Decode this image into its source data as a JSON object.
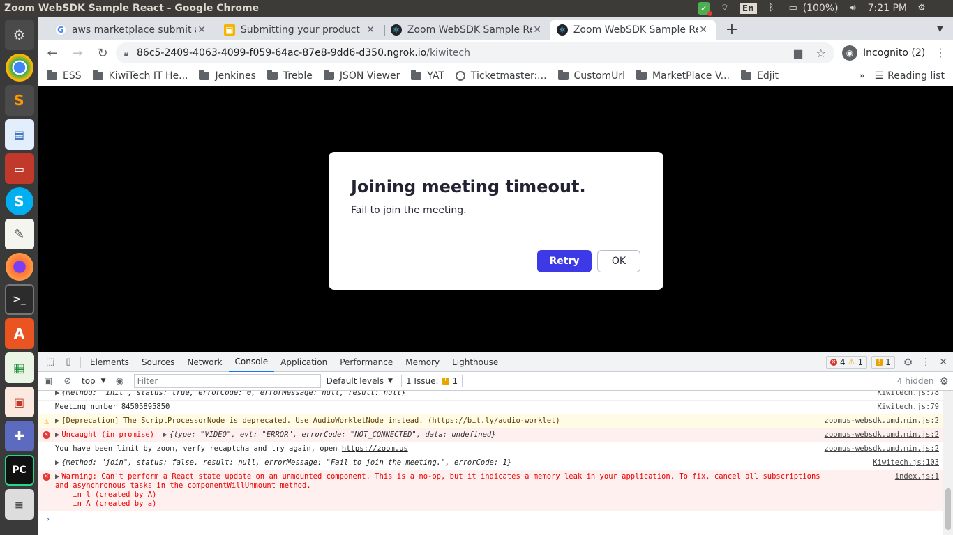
{
  "system": {
    "window_title": "Zoom WebSDK Sample React - Google Chrome",
    "battery": "(100%)",
    "time": "7:21 PM",
    "keyboard": "En"
  },
  "launcher": {
    "apps": [
      "settings",
      "chrome",
      "sublime-text",
      "image-viewer",
      "file-cabinet",
      "skype",
      "text-editor",
      "firefox",
      "terminal",
      "app-store",
      "spreadsheet",
      "presentation",
      "system-tools",
      "pycharm",
      "stack"
    ]
  },
  "tabs": [
    {
      "label": "aws marketplace submit a",
      "active": false
    },
    {
      "label": "Submitting your product",
      "active": false
    },
    {
      "label": "Zoom WebSDK Sample Re",
      "active": false
    },
    {
      "label": "Zoom WebSDK Sample Re",
      "active": true
    }
  ],
  "omnibox": {
    "host": "86c5-2409-4063-4099-f059-64ac-87e8-9dd6-d350.ngrok.io",
    "path": "/kiwitech"
  },
  "incognito_label": "Incognito (2)",
  "bookmarks": [
    "ESS",
    "KiwiTech IT He...",
    "Jenkines",
    "Treble",
    "JSON Viewer",
    "YAT",
    "Ticketmaster:...",
    "CustomUrl",
    "MarketPlace V...",
    "Edjit"
  ],
  "reading_list": "Reading list",
  "dialog": {
    "title": "Joining meeting timeout.",
    "message": "Fail to join the meeting.",
    "retry": "Retry",
    "ok": "OK"
  },
  "devtools": {
    "tabs": [
      "Elements",
      "Sources",
      "Network",
      "Console",
      "Application",
      "Performance",
      "Memory",
      "Lighthouse"
    ],
    "active_tab": "Console",
    "errors": "4",
    "warnings": "1",
    "issues": "1",
    "context": "top",
    "filter_placeholder": "Filter",
    "levels": "Default levels",
    "issue_btn": "1 Issue:",
    "issue_count": "1",
    "hidden": "4 hidden"
  },
  "console": {
    "lines": {
      "l0": {
        "text": "{method: \"init\", status: true, errorCode: 0, errorMessage: null, result: null}",
        "src": "Kiwitech.js:78"
      },
      "l1": {
        "text": "Meeting number 84505895850",
        "src": "Kiwitech.js:79"
      },
      "l2": {
        "text_pre": "[Deprecation] The ScriptProcessorNode is deprecated. Use AudioWorkletNode instead. (",
        "link": "https://bit.ly/audio-worklet",
        "text_post": ")",
        "src": "zoomus-websdk.umd.min.js:2"
      },
      "l3": {
        "text_pre": "Uncaught (in promise)",
        "obj": "{type: \"VIDEO\", evt: \"ERROR\", errorCode: \"NOT_CONNECTED\", data: undefined}",
        "src": "zoomus-websdk.umd.min.js:2"
      },
      "l4": {
        "text_pre": "You have been limit by zoom, verfy recaptcha and try again, open ",
        "link": "https://zoom.us",
        "src": "zoomus-websdk.umd.min.js:2"
      },
      "l5": {
        "text": "{method: \"join\", status: false, result: null, errorMessage: \"Fail to join the meeting.\", errorCode: 1}",
        "src": "Kiwitech.js:103"
      },
      "l6": {
        "line1": "Warning: Can't perform a React state update on an unmounted component. This is a no-op, but it indicates a memory leak in your application. To fix, cancel all subscriptions",
        "line2": "and asynchronous tasks in the componentWillUnmount method.",
        "line3": "    in l (created by A)",
        "line4": "    in A (created by a)",
        "src": "index.js:1"
      }
    }
  },
  "colors": {
    "accent": "#3d39e6",
    "error": "#e53935",
    "warning": "#e8a500"
  }
}
